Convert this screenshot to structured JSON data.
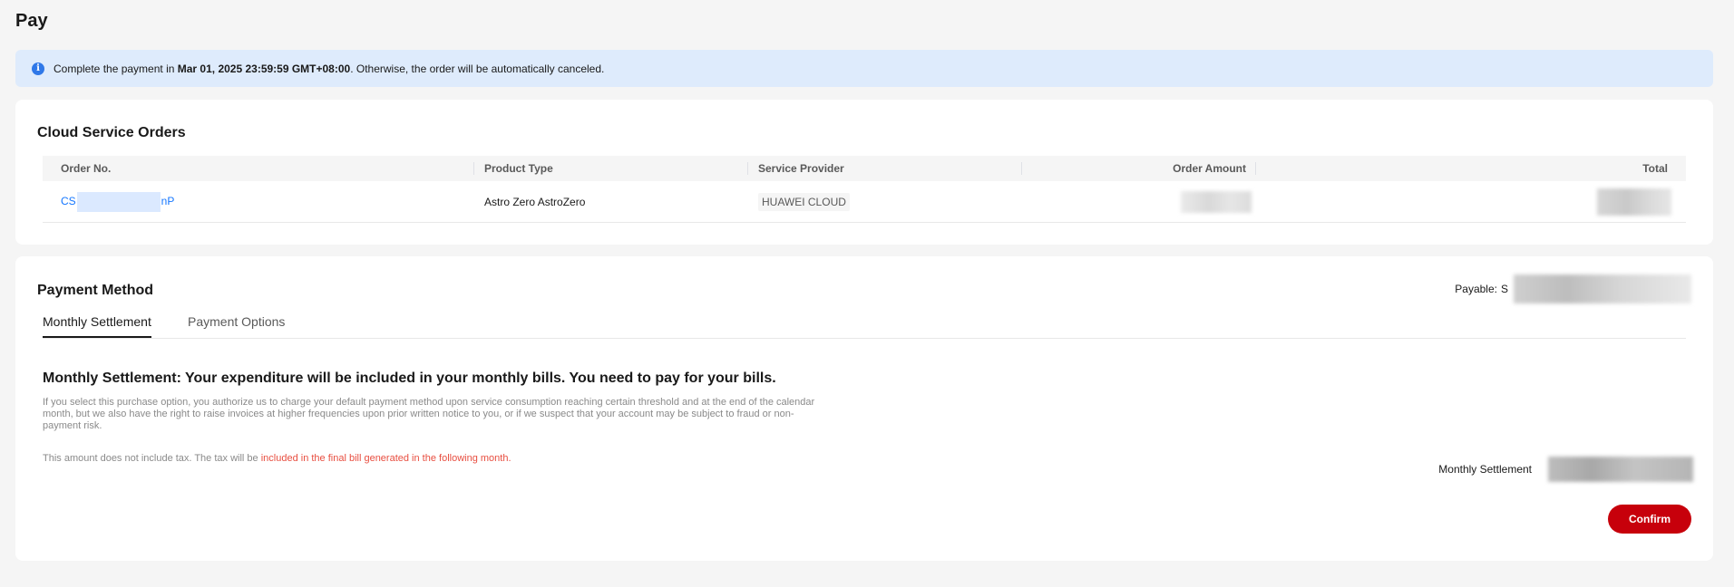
{
  "page": {
    "title": "Pay"
  },
  "notice": {
    "prefix": "Complete the payment in ",
    "deadline": "Mar 01, 2025 23:59:59 GMT+08:00",
    "suffix": ". Otherwise, the order will be automatically canceled."
  },
  "orders": {
    "title": "Cloud Service Orders",
    "columns": [
      "Order No.",
      "Product Type",
      "Service Provider",
      "Order Amount",
      "Total"
    ],
    "rows": [
      {
        "order_no_prefix": "CS",
        "order_no_suffix": "nP",
        "product_type": "Astro Zero AstroZero",
        "service_provider": "HUAWEI CLOUD"
      }
    ]
  },
  "payment": {
    "title": "Payable:",
    "section_title": "Payment Method",
    "payable_prefix": "S",
    "tabs": [
      {
        "label": "Monthly Settlement",
        "active": true
      },
      {
        "label": "Payment Options",
        "active": false
      }
    ],
    "heading": "Monthly Settlement: Your expenditure will be included in your monthly bills. You need to pay for your bills.",
    "description": "If you select this purchase option, you authorize us to charge your default payment method upon service consumption reaching certain threshold and at the end of the calendar month, but we also have the right to raise invoices at higher frequencies upon prior written notice to you, or if we suspect that your account may be subject to fraud or non-payment risk.",
    "tax_note_prefix": "This amount does not include tax. The tax will be ",
    "tax_note_highlight": "included in the final bill generated in the following month.",
    "settlement_label": "Monthly Settlement",
    "confirm_label": "Confirm"
  },
  "colors": {
    "accent": "#c7000b",
    "link": "#1476ff",
    "notice_bg": "#deebfc",
    "warning_text": "#e84e40"
  }
}
